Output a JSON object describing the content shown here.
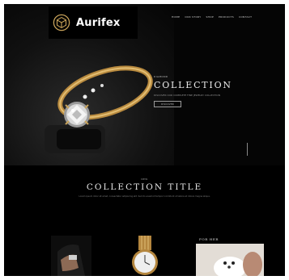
{
  "brand": {
    "name": "Aurifex"
  },
  "nav": [
    {
      "label": "HOME"
    },
    {
      "label": "OUR STORY"
    },
    {
      "label": "SHOP"
    },
    {
      "label": "PRODUCTS"
    },
    {
      "label": "CONTACT"
    }
  ],
  "hero": {
    "eyebrow": "DIAMOND",
    "title": "COLLECTION",
    "subtitle": "DISCOVER OUR COMPLETE FINE JEWELRY COLLECTION",
    "button_label": "DISCOVER"
  },
  "collection": {
    "eyebrow": "NEW",
    "title": "COLLECTION TITLE",
    "description": "Lorem ipsum dolor sit amet, consectetur adipiscing elit. Sed do eiusmod tempor incididunt ut labore et dolore magna aliqua."
  },
  "cards": [
    {
      "label": ""
    },
    {
      "label": ""
    },
    {
      "label": "FOR HER"
    }
  ],
  "colors": {
    "background": "#000000",
    "gold": "#c9a35a",
    "text": "#e6e6e6"
  }
}
